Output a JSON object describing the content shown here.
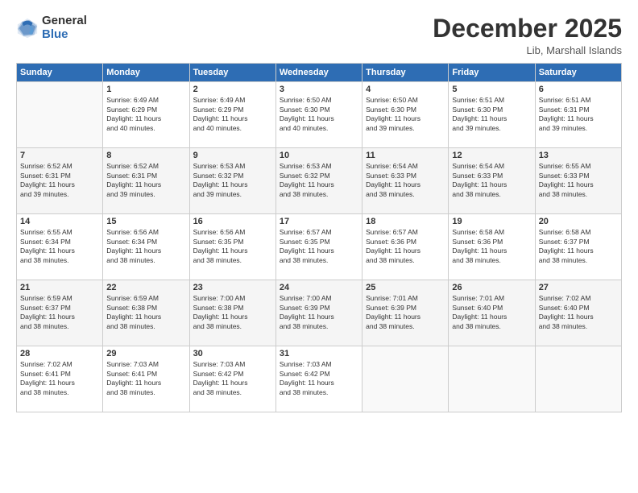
{
  "logo": {
    "general": "General",
    "blue": "Blue"
  },
  "header": {
    "month": "December 2025",
    "location": "Lib, Marshall Islands"
  },
  "days_of_week": [
    "Sunday",
    "Monday",
    "Tuesday",
    "Wednesday",
    "Thursday",
    "Friday",
    "Saturday"
  ],
  "weeks": [
    [
      {
        "day": "",
        "info": ""
      },
      {
        "day": "1",
        "info": "Sunrise: 6:49 AM\nSunset: 6:29 PM\nDaylight: 11 hours\nand 40 minutes."
      },
      {
        "day": "2",
        "info": "Sunrise: 6:49 AM\nSunset: 6:29 PM\nDaylight: 11 hours\nand 40 minutes."
      },
      {
        "day": "3",
        "info": "Sunrise: 6:50 AM\nSunset: 6:30 PM\nDaylight: 11 hours\nand 40 minutes."
      },
      {
        "day": "4",
        "info": "Sunrise: 6:50 AM\nSunset: 6:30 PM\nDaylight: 11 hours\nand 39 minutes."
      },
      {
        "day": "5",
        "info": "Sunrise: 6:51 AM\nSunset: 6:30 PM\nDaylight: 11 hours\nand 39 minutes."
      },
      {
        "day": "6",
        "info": "Sunrise: 6:51 AM\nSunset: 6:31 PM\nDaylight: 11 hours\nand 39 minutes."
      }
    ],
    [
      {
        "day": "7",
        "info": "Sunrise: 6:52 AM\nSunset: 6:31 PM\nDaylight: 11 hours\nand 39 minutes."
      },
      {
        "day": "8",
        "info": "Sunrise: 6:52 AM\nSunset: 6:31 PM\nDaylight: 11 hours\nand 39 minutes."
      },
      {
        "day": "9",
        "info": "Sunrise: 6:53 AM\nSunset: 6:32 PM\nDaylight: 11 hours\nand 39 minutes."
      },
      {
        "day": "10",
        "info": "Sunrise: 6:53 AM\nSunset: 6:32 PM\nDaylight: 11 hours\nand 38 minutes."
      },
      {
        "day": "11",
        "info": "Sunrise: 6:54 AM\nSunset: 6:33 PM\nDaylight: 11 hours\nand 38 minutes."
      },
      {
        "day": "12",
        "info": "Sunrise: 6:54 AM\nSunset: 6:33 PM\nDaylight: 11 hours\nand 38 minutes."
      },
      {
        "day": "13",
        "info": "Sunrise: 6:55 AM\nSunset: 6:33 PM\nDaylight: 11 hours\nand 38 minutes."
      }
    ],
    [
      {
        "day": "14",
        "info": "Sunrise: 6:55 AM\nSunset: 6:34 PM\nDaylight: 11 hours\nand 38 minutes."
      },
      {
        "day": "15",
        "info": "Sunrise: 6:56 AM\nSunset: 6:34 PM\nDaylight: 11 hours\nand 38 minutes."
      },
      {
        "day": "16",
        "info": "Sunrise: 6:56 AM\nSunset: 6:35 PM\nDaylight: 11 hours\nand 38 minutes."
      },
      {
        "day": "17",
        "info": "Sunrise: 6:57 AM\nSunset: 6:35 PM\nDaylight: 11 hours\nand 38 minutes."
      },
      {
        "day": "18",
        "info": "Sunrise: 6:57 AM\nSunset: 6:36 PM\nDaylight: 11 hours\nand 38 minutes."
      },
      {
        "day": "19",
        "info": "Sunrise: 6:58 AM\nSunset: 6:36 PM\nDaylight: 11 hours\nand 38 minutes."
      },
      {
        "day": "20",
        "info": "Sunrise: 6:58 AM\nSunset: 6:37 PM\nDaylight: 11 hours\nand 38 minutes."
      }
    ],
    [
      {
        "day": "21",
        "info": "Sunrise: 6:59 AM\nSunset: 6:37 PM\nDaylight: 11 hours\nand 38 minutes."
      },
      {
        "day": "22",
        "info": "Sunrise: 6:59 AM\nSunset: 6:38 PM\nDaylight: 11 hours\nand 38 minutes."
      },
      {
        "day": "23",
        "info": "Sunrise: 7:00 AM\nSunset: 6:38 PM\nDaylight: 11 hours\nand 38 minutes."
      },
      {
        "day": "24",
        "info": "Sunrise: 7:00 AM\nSunset: 6:39 PM\nDaylight: 11 hours\nand 38 minutes."
      },
      {
        "day": "25",
        "info": "Sunrise: 7:01 AM\nSunset: 6:39 PM\nDaylight: 11 hours\nand 38 minutes."
      },
      {
        "day": "26",
        "info": "Sunrise: 7:01 AM\nSunset: 6:40 PM\nDaylight: 11 hours\nand 38 minutes."
      },
      {
        "day": "27",
        "info": "Sunrise: 7:02 AM\nSunset: 6:40 PM\nDaylight: 11 hours\nand 38 minutes."
      }
    ],
    [
      {
        "day": "28",
        "info": "Sunrise: 7:02 AM\nSunset: 6:41 PM\nDaylight: 11 hours\nand 38 minutes."
      },
      {
        "day": "29",
        "info": "Sunrise: 7:03 AM\nSunset: 6:41 PM\nDaylight: 11 hours\nand 38 minutes."
      },
      {
        "day": "30",
        "info": "Sunrise: 7:03 AM\nSunset: 6:42 PM\nDaylight: 11 hours\nand 38 minutes."
      },
      {
        "day": "31",
        "info": "Sunrise: 7:03 AM\nSunset: 6:42 PM\nDaylight: 11 hours\nand 38 minutes."
      },
      {
        "day": "",
        "info": ""
      },
      {
        "day": "",
        "info": ""
      },
      {
        "day": "",
        "info": ""
      }
    ]
  ]
}
